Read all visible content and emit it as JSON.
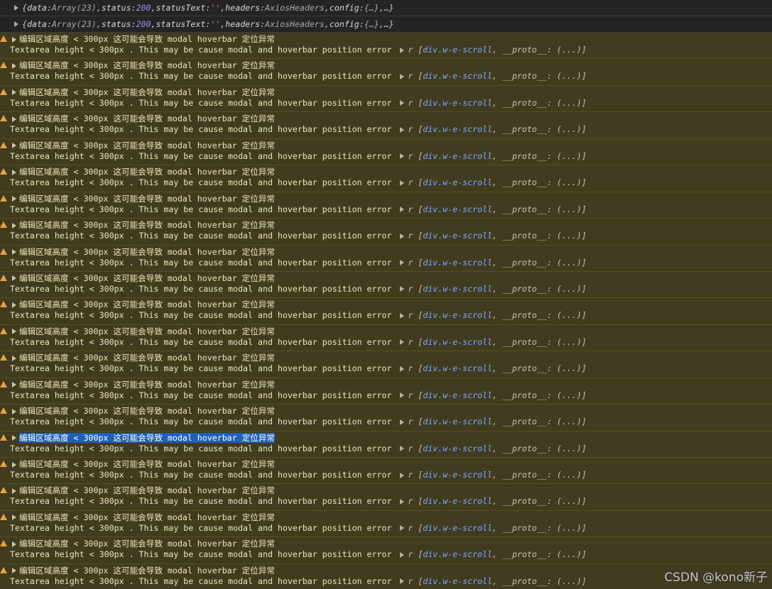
{
  "log_rows": [
    {
      "prefix": "{",
      "k_data": "data",
      "v_data": "Array(23)",
      "k_status": "status",
      "v_status": "200",
      "k_statusText": "statusText",
      "v_statusText": "''",
      "k_headers": "headers",
      "v_headers": "AxiosHeaders",
      "k_config": "config",
      "v_config": "{…}",
      "suffix": "…}"
    },
    {
      "prefix": "{",
      "k_data": "data",
      "v_data": "Array(23)",
      "k_status": "status",
      "v_status": "200",
      "k_statusText": "statusText",
      "v_statusText": "''",
      "k_headers": "headers",
      "v_headers": "AxiosHeaders",
      "k_config": "config",
      "v_config": "{…}",
      "suffix": "…}"
    }
  ],
  "warning": {
    "zh_message": "编辑区域高度 < 300px 这可能会导致 modal hoverbar 定位异常",
    "en_message": "Textarea height < 300px . This may be cause modal and hoverbar position error",
    "obj_var": "r",
    "obj_open": "[",
    "obj_el": "div.w-e-scroll",
    "obj_sep": ", ",
    "obj_proto": "__proto__: (...)",
    "obj_close": "]",
    "count": 21,
    "selected_index": 15
  },
  "watermark": "CSDN @kono新子",
  "colors": {
    "warning_bg": "#413b20",
    "warning_icon": "#e7a33c",
    "selection": "#1f5fb8",
    "console_bg": "#242424"
  }
}
